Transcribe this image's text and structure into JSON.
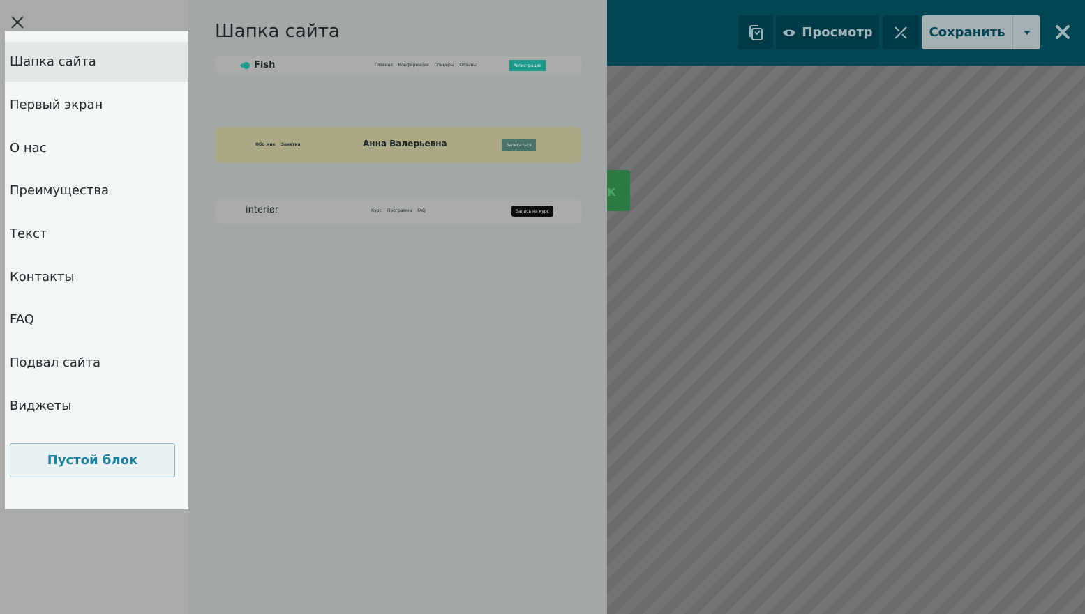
{
  "topbar": {
    "preview_label": "Просмотр",
    "save_label": "Сохранить"
  },
  "background": {
    "green_fragment_text": "к"
  },
  "categories": {
    "items": [
      {
        "label": "Шапка сайта"
      },
      {
        "label": "Первый экран"
      },
      {
        "label": "О нас"
      },
      {
        "label": "Преимущества"
      },
      {
        "label": "Текст"
      },
      {
        "label": "Контакты"
      },
      {
        "label": "FAQ"
      },
      {
        "label": "Подвал сайта"
      },
      {
        "label": "Виджеты"
      }
    ],
    "active_index": 0,
    "empty_block_label": "Пустой блок"
  },
  "preview": {
    "title": "Шапка сайта",
    "thumbnails": [
      {
        "logo": "Fish",
        "nav": [
          "Главная",
          "Конференция",
          "Спикеры",
          "Отзывы"
        ],
        "button": "Регистрация"
      },
      {
        "logo": "Анна Валерьевна",
        "nav": [
          "Обо мне",
          "Занятия"
        ],
        "button": "Записаться"
      },
      {
        "logo": "interiør",
        "nav": [
          "Курс",
          "Программа",
          "FAQ"
        ],
        "button": "Запись на курс"
      }
    ]
  },
  "colors": {
    "topbar": "#024553",
    "accent_teal": "#1c9a8a",
    "link_blue": "#1a7f9b"
  }
}
